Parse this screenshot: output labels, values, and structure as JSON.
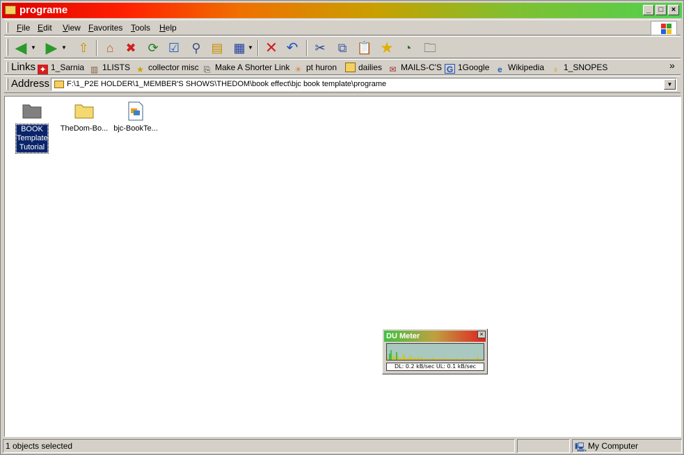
{
  "window": {
    "title": "programe"
  },
  "menu": {
    "items": [
      {
        "key": "F",
        "rest": "ile"
      },
      {
        "key": "E",
        "rest": "dit"
      },
      {
        "key": "V",
        "rest": "iew"
      },
      {
        "key": "F",
        "rest": "avorites",
        "prefix": ""
      },
      {
        "key": "T",
        "rest": "ools"
      },
      {
        "key": "H",
        "rest": "elp"
      }
    ]
  },
  "links": {
    "label": "Links",
    "items": [
      "1_Sarnia",
      "1LISTS",
      "collector misc",
      "Make A Shorter Link",
      "pt huron",
      "dailies",
      "MAILS-C'S",
      "1Google",
      "Wikipedia",
      "1_SNOPES"
    ],
    "chevron": "»"
  },
  "address": {
    "label": "Address",
    "value": "F:\\1_P2E HOLDER\\1_MEMBER'S SHOWS\\THEDOM\\book effect\\bjc book template\\programe"
  },
  "files": [
    {
      "name": "BOOK Template Tutorial",
      "icon": "folder-gray-icon",
      "selected": true
    },
    {
      "name": "TheDom-Bo...",
      "icon": "folder-icon",
      "selected": false
    },
    {
      "name": "bjc-BookTe...",
      "icon": "document-icon",
      "selected": false
    }
  ],
  "dumeter": {
    "title": "DU Meter",
    "stats": "DL: 0.2 kB/sec   UL: 0.1 kB/sec",
    "close": "×"
  },
  "status": {
    "selection": "1 objects selected",
    "location": "My Computer"
  },
  "colors": {
    "selection": "#0a246a",
    "face": "#d4d0c8"
  }
}
